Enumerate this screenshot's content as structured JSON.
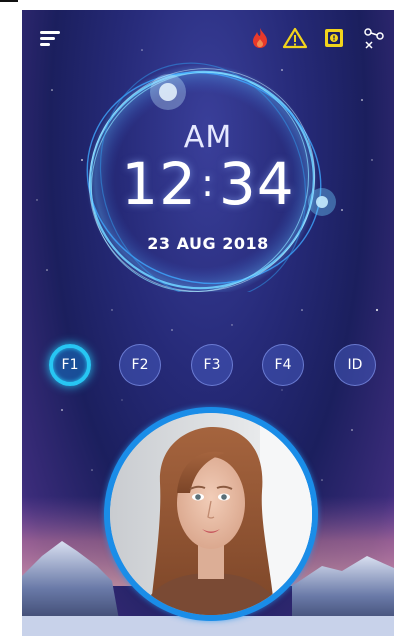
{
  "status_icons": [
    "menu-icon",
    "fire-icon",
    "warning-icon",
    "alert-icon",
    "network-icon"
  ],
  "clock": {
    "period": "AM",
    "hours": "12",
    "separator": ":",
    "minutes": "34",
    "date": "23 AUG 2018"
  },
  "function_keys": [
    {
      "label": "F1",
      "active": true
    },
    {
      "label": "F2",
      "active": false
    },
    {
      "label": "F3",
      "active": false
    },
    {
      "label": "F4",
      "active": false
    },
    {
      "label": "ID",
      "active": false
    }
  ],
  "colors": {
    "accent": "#27c6f3",
    "face_ring": "#1a8de8",
    "fire": "#e8392a",
    "warning": "#f2d41c"
  }
}
